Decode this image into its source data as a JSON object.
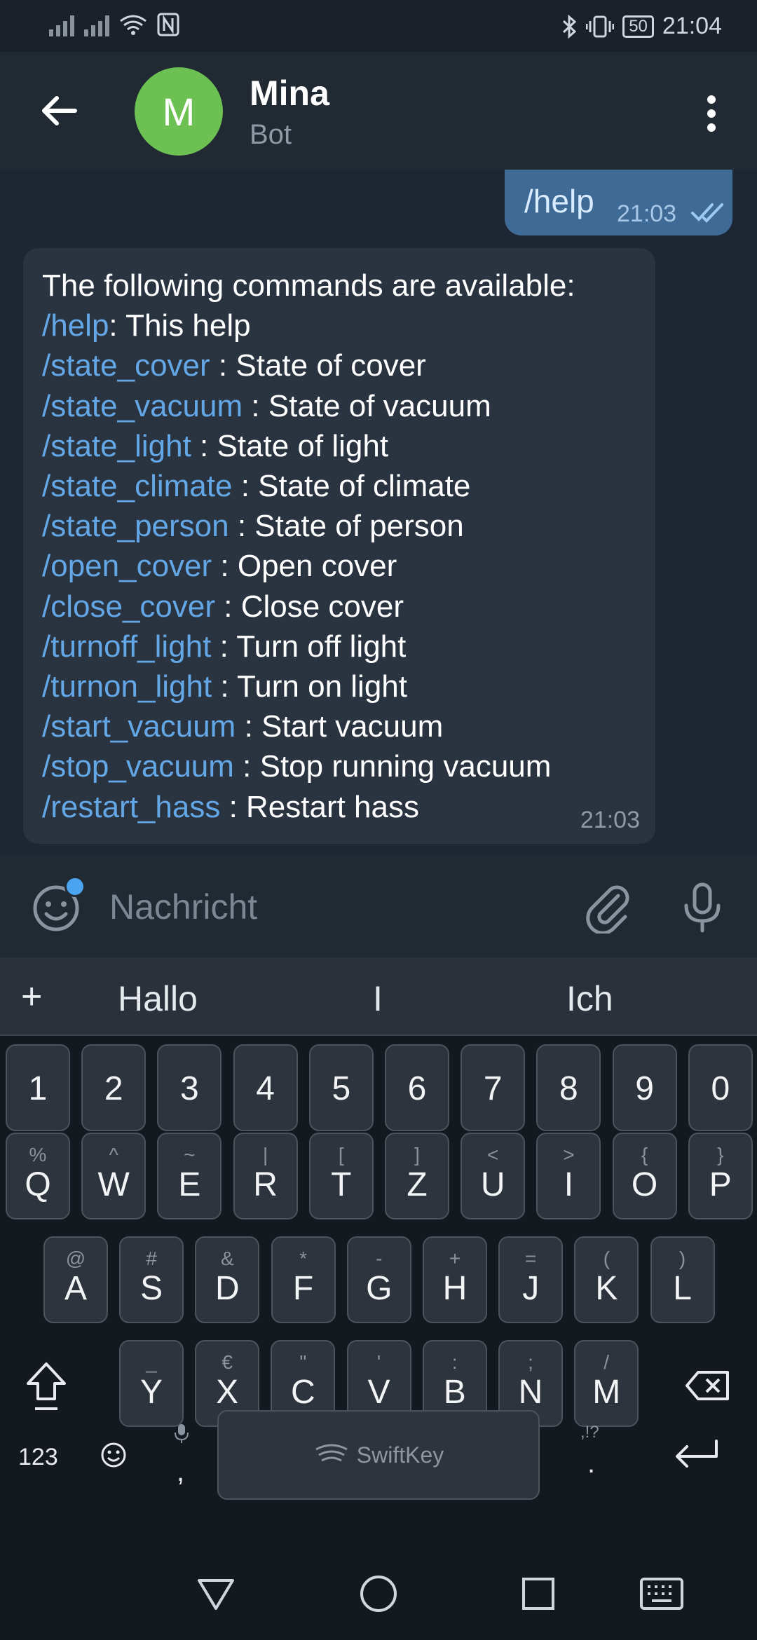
{
  "status_bar": {
    "battery": "50",
    "time": "21:04"
  },
  "header": {
    "avatar_letter": "M",
    "title": "Mina",
    "subtitle": "Bot"
  },
  "outgoing": {
    "text": "/help",
    "time": "21:03"
  },
  "incoming": {
    "intro": "The following commands are available:",
    "commands": [
      {
        "cmd": "/help",
        "desc": ": This help"
      },
      {
        "cmd": "/state_cover",
        "desc": " : State of cover"
      },
      {
        "cmd": "/state_vacuum",
        "desc": " : State of vacuum"
      },
      {
        "cmd": "/state_light",
        "desc": " : State of light"
      },
      {
        "cmd": "/state_climate",
        "desc": " : State of climate"
      },
      {
        "cmd": "/state_person",
        "desc": " : State of person"
      },
      {
        "cmd": "/open_cover",
        "desc": " : Open cover"
      },
      {
        "cmd": "/close_cover",
        "desc": " : Close cover"
      },
      {
        "cmd": "/turnoff_light",
        "desc": " : Turn off light"
      },
      {
        "cmd": "/turnon_light",
        "desc": " : Turn on light"
      },
      {
        "cmd": "/start_vacuum",
        "desc": " : Start vacuum"
      },
      {
        "cmd": "/stop_vacuum",
        "desc": " : Stop running vacuum"
      },
      {
        "cmd": "/restart_hass",
        "desc": " : Restart hass"
      }
    ],
    "time": "21:03"
  },
  "input": {
    "placeholder": "Nachricht"
  },
  "keyboard": {
    "suggestions": [
      "Hallo",
      "I",
      "Ich"
    ],
    "plus": "+",
    "numbers": [
      "1",
      "2",
      "3",
      "4",
      "5",
      "6",
      "7",
      "8",
      "9",
      "0"
    ],
    "row1": [
      [
        "%",
        "Q"
      ],
      [
        "^",
        "W"
      ],
      [
        "~",
        "E"
      ],
      [
        "|",
        "R"
      ],
      [
        "[",
        "T"
      ],
      [
        "]",
        "Z"
      ],
      [
        "<",
        "U"
      ],
      [
        ">",
        "I"
      ],
      [
        "{",
        "O"
      ],
      [
        "}",
        "P"
      ]
    ],
    "row2": [
      [
        "@",
        "A"
      ],
      [
        "#",
        "S"
      ],
      [
        "&",
        "D"
      ],
      [
        "*",
        "F"
      ],
      [
        "-",
        "G"
      ],
      [
        "+",
        "H"
      ],
      [
        "=",
        "J"
      ],
      [
        "(",
        "K"
      ],
      [
        ")",
        "L"
      ]
    ],
    "row3": [
      [
        "_",
        "Y"
      ],
      [
        "€",
        "X"
      ],
      [
        "\"",
        "C"
      ],
      [
        "'",
        "V"
      ],
      [
        ":",
        "B"
      ],
      [
        ";",
        "N"
      ],
      [
        "/",
        "M"
      ]
    ],
    "num_switch": "123",
    "comma": ",",
    "period": ".",
    "period_alt": ",!?",
    "space_label": "SwiftKey"
  },
  "colors": {
    "accent": "#64a7e6",
    "bubble_out": "#3e6a95",
    "bubble_in": "#2a3440",
    "avatar": "#6cc152"
  }
}
